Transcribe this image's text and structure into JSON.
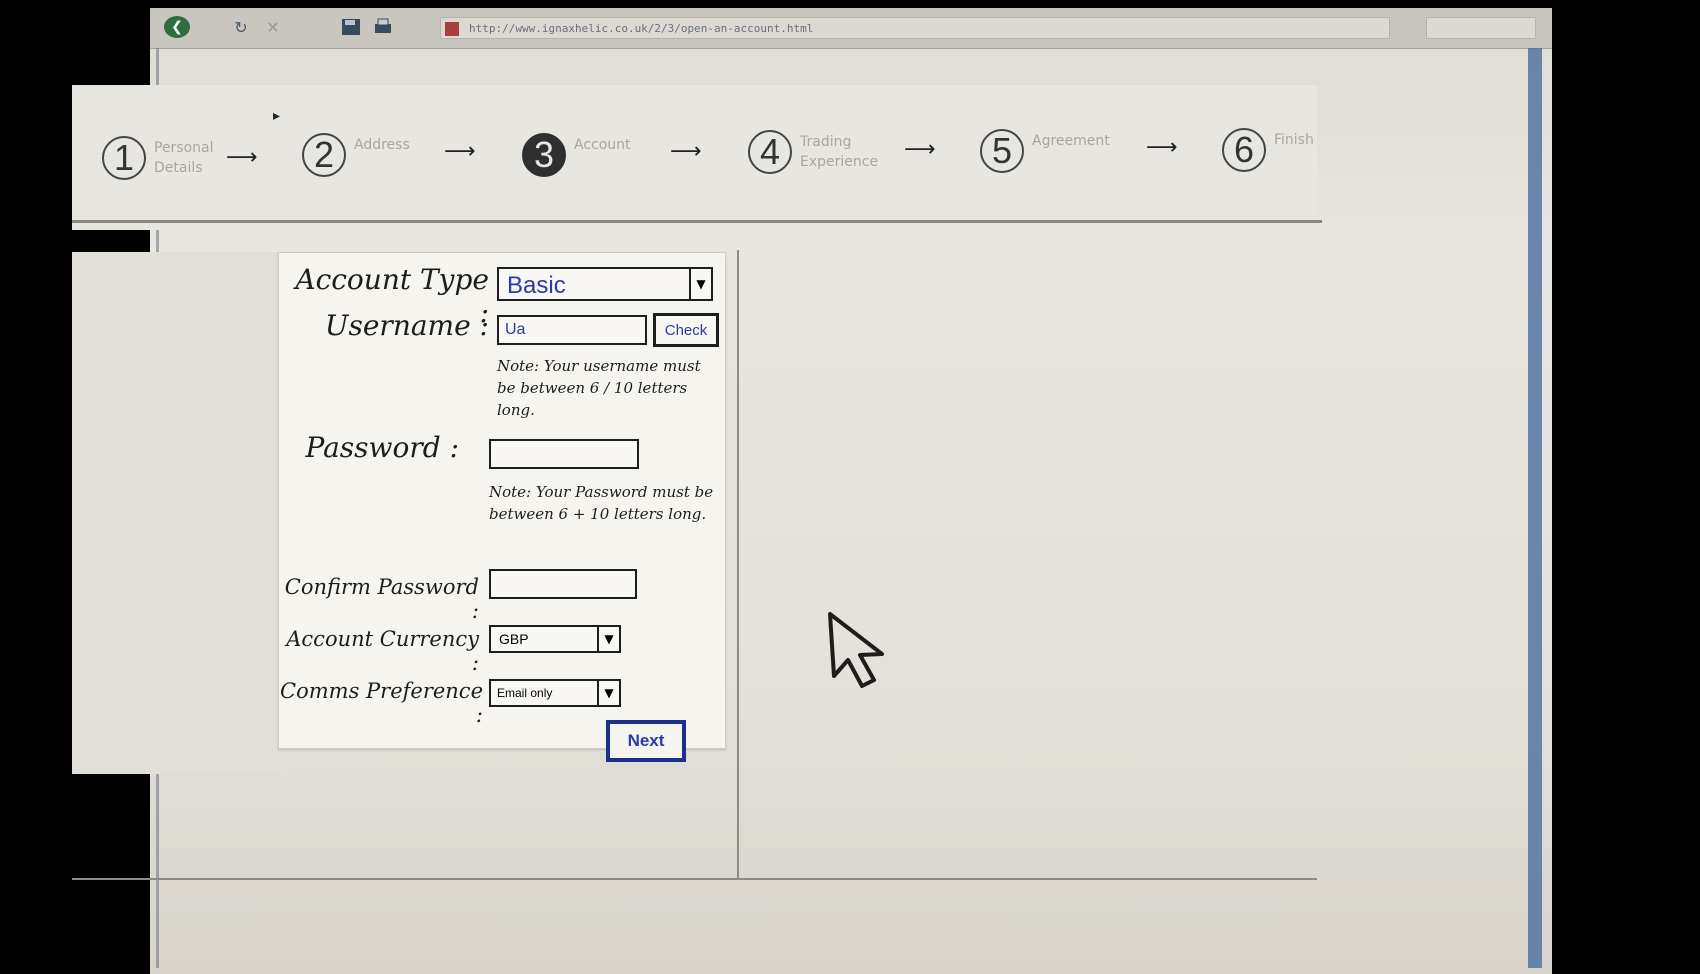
{
  "browser": {
    "url": "http://www.ignaxhelic.co.uk/2/3/open-an-account.html",
    "search_placeholder": "",
    "back_glyph": "❮",
    "refresh_glyph": "↻",
    "stop_glyph": "✕"
  },
  "steps": [
    {
      "num": "1",
      "label": "Personal Details",
      "active": false
    },
    {
      "num": "2",
      "label": "Address",
      "active": false
    },
    {
      "num": "3",
      "label": "Account",
      "active": true
    },
    {
      "num": "4",
      "label": "Trading Experience",
      "active": false
    },
    {
      "num": "5",
      "label": "Agreement",
      "active": false
    },
    {
      "num": "6",
      "label": "Finish",
      "active": false
    }
  ],
  "form": {
    "account_type_label": "Account Type :",
    "account_type_value": "Basic",
    "username_label": "Username :",
    "username_value": "Ua",
    "check_button": "Check",
    "username_note": "Note: Your username must be between 6 / 10 letters long.",
    "password_label": "Password :",
    "password_value": "",
    "password_note": "Note: Your Password must be between 6 + 10 letters long.",
    "confirm_password_label": "Confirm Password :",
    "confirm_password_value": "",
    "account_currency_label": "Account Currency :",
    "account_currency_value": "GBP",
    "comms_preference_label": "Comms Preference :",
    "comms_preference_value": "Email only"
  },
  "next_button": "Next",
  "colors": {
    "ink": "#1d1d1d",
    "blue_ink": "#2b3aa8",
    "paper": "#f5f4ef"
  }
}
